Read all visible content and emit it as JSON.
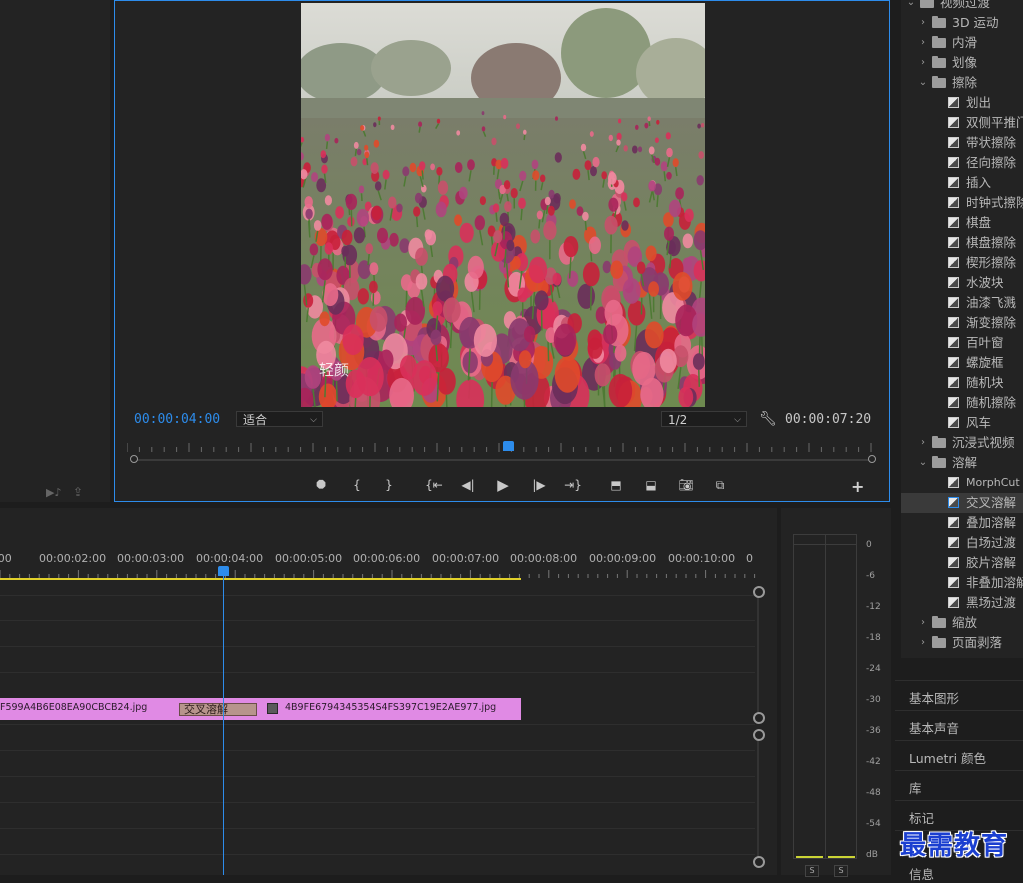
{
  "monitor": {
    "current_timecode": "00:00:04:00",
    "duration_timecode": "00:00:07:20",
    "fit": "适合",
    "resolution": "1/2",
    "photo_watermark": "轻颜"
  },
  "effects": {
    "items": [
      {
        "label": "视频过渡",
        "type": "folder",
        "level": 0,
        "open": true
      },
      {
        "label": "3D 运动",
        "type": "folder",
        "level": 1,
        "open": false
      },
      {
        "label": "内滑",
        "type": "folder",
        "level": 1,
        "open": false
      },
      {
        "label": "划像",
        "type": "folder",
        "level": 1,
        "open": false
      },
      {
        "label": "擦除",
        "type": "folder",
        "level": 1,
        "open": true
      },
      {
        "label": "划出",
        "type": "effect"
      },
      {
        "label": "双侧平推门",
        "type": "effect"
      },
      {
        "label": "带状擦除",
        "type": "effect"
      },
      {
        "label": "径向擦除",
        "type": "effect"
      },
      {
        "label": "插入",
        "type": "effect"
      },
      {
        "label": "时钟式擦除",
        "type": "effect"
      },
      {
        "label": "棋盘",
        "type": "effect"
      },
      {
        "label": "棋盘擦除",
        "type": "effect"
      },
      {
        "label": "楔形擦除",
        "type": "effect"
      },
      {
        "label": "水波块",
        "type": "effect"
      },
      {
        "label": "油漆飞溅",
        "type": "effect"
      },
      {
        "label": "渐变擦除",
        "type": "effect"
      },
      {
        "label": "百叶窗",
        "type": "effect"
      },
      {
        "label": "螺旋框",
        "type": "effect"
      },
      {
        "label": "随机块",
        "type": "effect"
      },
      {
        "label": "随机擦除",
        "type": "effect"
      },
      {
        "label": "风车",
        "type": "effect"
      },
      {
        "label": "沉浸式视频",
        "type": "folder",
        "level": 1,
        "open": false
      },
      {
        "label": "溶解",
        "type": "folder",
        "level": 1,
        "open": true
      },
      {
        "label": "MorphCut",
        "type": "effect"
      },
      {
        "label": "交叉溶解",
        "type": "effect",
        "selected": true
      },
      {
        "label": "叠加溶解",
        "type": "effect"
      },
      {
        "label": "白场过渡",
        "type": "effect"
      },
      {
        "label": "胶片溶解",
        "type": "effect"
      },
      {
        "label": "非叠加溶解",
        "type": "effect"
      },
      {
        "label": "黑场过渡",
        "type": "effect"
      },
      {
        "label": "缩放",
        "type": "folder",
        "level": 1,
        "open": false
      },
      {
        "label": "页面剥落",
        "type": "folder",
        "level": 1,
        "open": false
      }
    ]
  },
  "timeline": {
    "ruler": [
      ":00",
      "00:00:02:00",
      "00:00:03:00",
      "00:00:04:00",
      "00:00:05:00",
      "00:00:06:00",
      "00:00:07:00",
      "00:00:08:00",
      "00:00:09:00",
      "00:00:10:00",
      "0"
    ],
    "clip_a": "F599A4B6E08EA90CBCB24.jpg",
    "clip_b": "4B9FE6794345354S4FS397C19E2AE977.jpg",
    "transition": "交叉溶解"
  },
  "meter": {
    "scale": [
      "0",
      "-6",
      "-12",
      "-18",
      "-24",
      "-30",
      "-36",
      "-42",
      "-48",
      "-54",
      "dB"
    ],
    "solo_left": "S",
    "solo_right": "S"
  },
  "panels": {
    "tabs": [
      "基本图形",
      "基本声音",
      "Lumetri 颜色",
      "库",
      "标记",
      "信息"
    ]
  },
  "watermark": "最需教育",
  "colors": {
    "accent": "#2d8ceb",
    "clip": "#e08ae4",
    "transition": "#b7948c",
    "work_area": "#e0d02a"
  }
}
